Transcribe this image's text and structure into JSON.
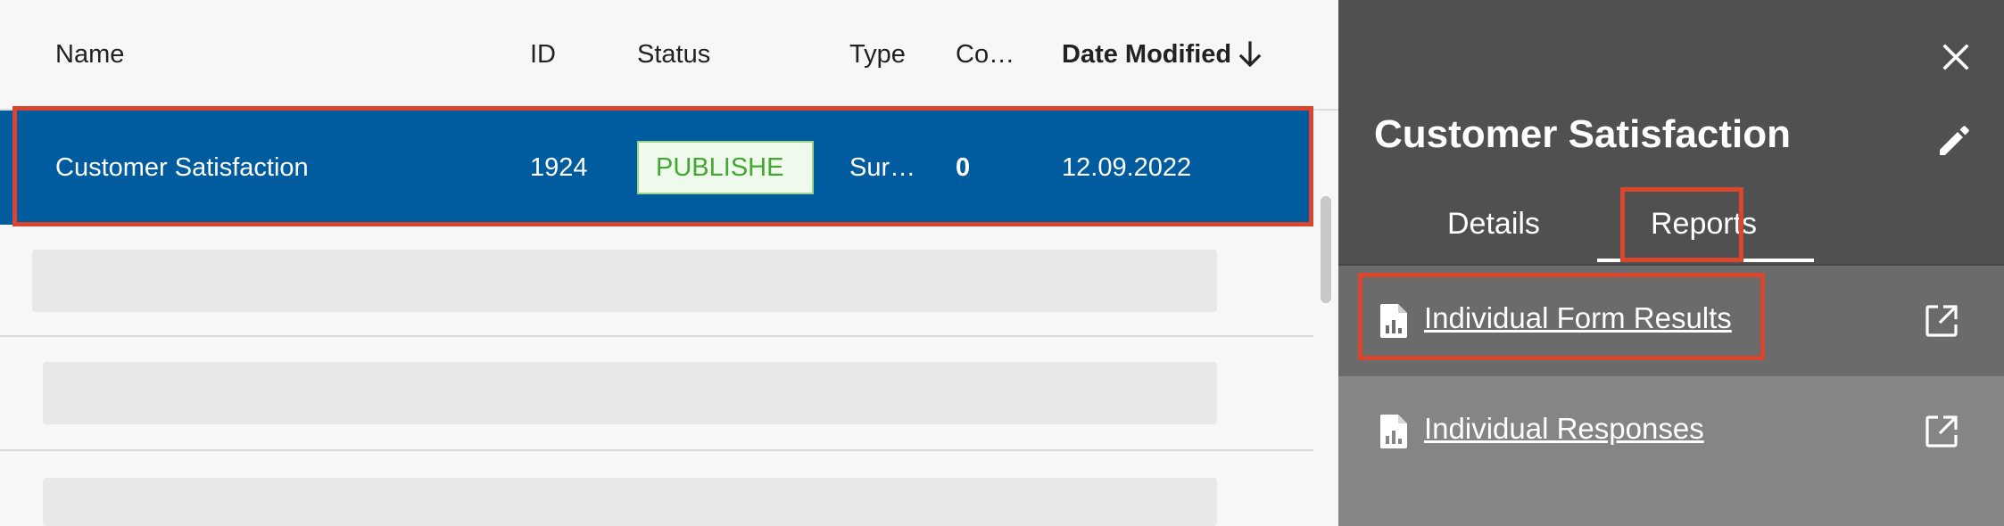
{
  "table": {
    "columns": {
      "name": "Name",
      "id": "ID",
      "status": "Status",
      "type": "Type",
      "count": "Co…",
      "date_modified": "Date Modified"
    },
    "sort": {
      "column": "date_modified",
      "direction": "descending",
      "icon": "arrow-down-icon"
    },
    "selected_row": {
      "name": "Customer Satisfaction",
      "id": "1924",
      "status": "PUBLISHE",
      "type": "Sur…",
      "count": "0",
      "date_modified": "12.09.2022"
    }
  },
  "panel": {
    "title": "Customer Satisfaction",
    "close_icon": "close-icon",
    "edit_icon": "pencil-icon",
    "tabs": [
      {
        "label": "Details",
        "active": false
      },
      {
        "label": "Reports",
        "active": true
      }
    ],
    "reports": [
      {
        "label": "Individual Form Results",
        "icon": "report-file-icon",
        "action_icon": "open-external-icon"
      },
      {
        "label": "Individual Responses",
        "icon": "report-file-icon",
        "action_icon": "open-external-icon"
      }
    ]
  },
  "colors": {
    "selected_row": "#005c9e",
    "highlight": "#d9452d",
    "status_text": "#43a832",
    "panel_bg": "#505050"
  }
}
